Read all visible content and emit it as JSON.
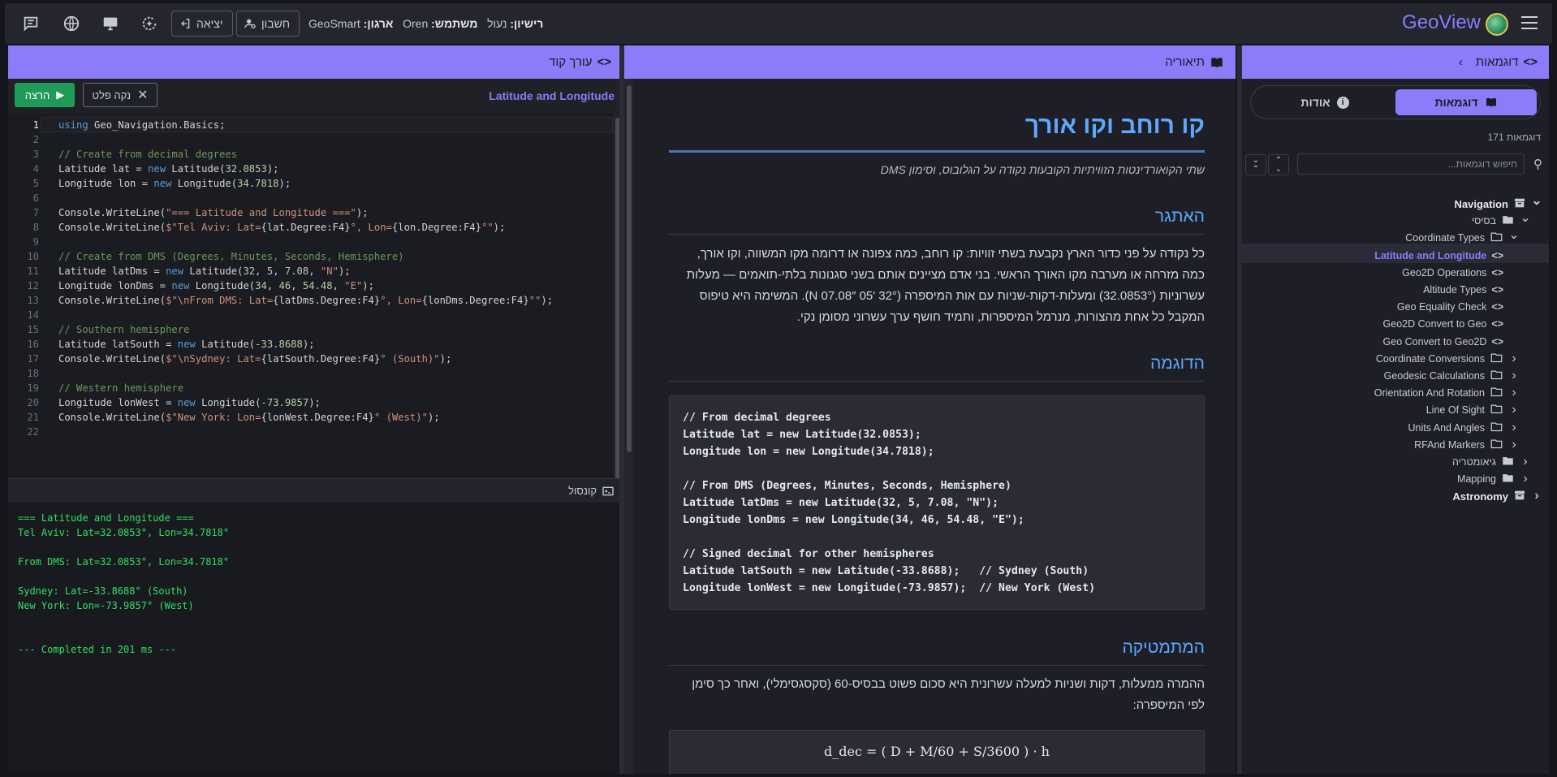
{
  "topbar": {
    "brand": "GeoView",
    "org_label": "ארגון:",
    "org_value": "GeoSmart",
    "user_label": "משתמש:",
    "user_value": "Oren",
    "license_label": "רישיון:",
    "license_value": "נעול",
    "account_label": "חשבון",
    "logout_label": "יציאה"
  },
  "code_panel": {
    "title": "עורך קוד",
    "run_label": "הרצה",
    "clear_label": "נקה פלט",
    "file_title": "Latitude and Longitude",
    "console_title": "קונסול",
    "console_lines": [
      "=== Latitude and Longitude ===",
      "Tel Aviv: Lat=32.0853°, Lon=34.7818°",
      "",
      "From DMS: Lat=32.0853°, Lon=34.7818°",
      "",
      "Sydney: Lat=-33.8688° (South)",
      "New York: Lon=-73.9857° (West)",
      "",
      "",
      "--- Completed in 201 ms ---"
    ]
  },
  "theory": {
    "panel_title": "תיאוריה",
    "title": "קו רוחב וקו אורך",
    "subtitle": "שתי הקואורדינטות הזוויתיות הקובעות נקודה על הגלובוס, וסימון DMS",
    "h_challenge": "האתגר",
    "challenge_lines": [
      "כל נקודה על פני כדור הארץ נקבעת בשתי זוויות: קו רוחב, כמה צפונה או דרומה מקו המשווה, וקו אורך,",
      "כמה מזרחה או מערבה מקו האורך הראשי. בני אדם מציינים אותם בשני סגנונות בלתי-תואמים — מעלות",
      "עשרוניות (32.0853°) ומעלות-דקות-שניות עם אות המיספרה (32° 05′ 07.08″ N). המשימה היא טיפוס",
      "המקבל כל אחת מהצורות, מנרמל המיספרות, ותמיד חושף ערך עשרוני מסומן נקי."
    ],
    "h_example": "הדוגמה",
    "code_lines": [
      "// From decimal degrees",
      "Latitude lat = new Latitude(32.0853);",
      "Longitude lon = new Longitude(34.7818);",
      "",
      "// From DMS (Degrees, Minutes, Seconds, Hemisphere)",
      "Latitude latDms = new Latitude(32, 5, 7.08, \"N\");",
      "Longitude lonDms = new Longitude(34, 46, 54.48, \"E\");",
      "",
      "// Signed decimal for other hemispheres",
      "Latitude latSouth = new Latitude(-33.8688);   // Sydney (South)",
      "Longitude lonWest = new Longitude(-73.9857);  // New York (West)"
    ],
    "h_math": "המתמטיקה",
    "math_lines": [
      "ההמרה ממעלות, דקות ושניות למעלה עשרונית היא סכום פשוט בבסיס-60 (סקסגסימלי), ואחר כך סימן",
      "לפי המיספרה:"
    ],
    "formula": "d_dec = ( D + M/60 + S/3600 ) · h"
  },
  "examples": {
    "panel_title": "דוגמאות",
    "tab_examples": "דוגמאות",
    "tab_about": "אודות",
    "count": "171 דוגמאות",
    "search_placeholder": "חיפוש דוגמאות...",
    "tree": [
      {
        "label": "Navigation",
        "level": 0,
        "kind": "root",
        "chev": "v"
      },
      {
        "label": "בסיסי",
        "level": 1,
        "kind": "folder-filled",
        "chev": "v"
      },
      {
        "label": "Coordinate Types",
        "level": 2,
        "kind": "folder",
        "chev": "v"
      },
      {
        "label": "Latitude and Longitude",
        "level": 3,
        "kind": "code",
        "chev": "code",
        "selected": true
      },
      {
        "label": "Geo2D Operations",
        "level": 3,
        "kind": "code",
        "chev": "code"
      },
      {
        "label": "Altitude Types",
        "level": 3,
        "kind": "code",
        "chev": "code"
      },
      {
        "label": "Geo Equality Check",
        "level": 3,
        "kind": "code",
        "chev": "code"
      },
      {
        "label": "Geo2D Convert to Geo",
        "level": 3,
        "kind": "code",
        "chev": "code"
      },
      {
        "label": "Geo Convert to Geo2D",
        "level": 3,
        "kind": "code",
        "chev": "code"
      },
      {
        "label": "Coordinate Conversions",
        "level": 2,
        "kind": "folder",
        "chev": ">"
      },
      {
        "label": "Geodesic Calculations",
        "level": 2,
        "kind": "folder",
        "chev": ">"
      },
      {
        "label": "Orientation And Rotation",
        "level": 2,
        "kind": "folder",
        "chev": ">"
      },
      {
        "label": "Line Of Sight",
        "level": 2,
        "kind": "folder",
        "chev": ">"
      },
      {
        "label": "Units And Angles",
        "level": 2,
        "kind": "folder",
        "chev": ">"
      },
      {
        "label": "RFAnd Markers",
        "level": 2,
        "kind": "folder",
        "chev": ">"
      },
      {
        "label": "גיאומטריה",
        "level": 1,
        "kind": "folder-filled",
        "chev": ">"
      },
      {
        "label": "Mapping",
        "level": 1,
        "kind": "folder-filled",
        "chev": ">"
      },
      {
        "label": "Astronomy",
        "level": 0,
        "kind": "root",
        "chev": ">"
      }
    ]
  },
  "colors": {
    "accent": "#8b7cf9",
    "heading": "#5ea8ff",
    "run": "#1f9a57",
    "console": "#2fe05f"
  }
}
